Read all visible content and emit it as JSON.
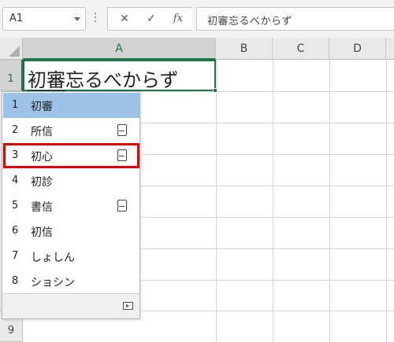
{
  "formula_bar": {
    "name_box": "A1",
    "cancel_icon": "✕",
    "enter_icon": "✓",
    "function_icon": "fx",
    "content": "初審忘るべからず"
  },
  "columns": [
    "A",
    "B",
    "C",
    "D"
  ],
  "rows": [
    "1",
    "9"
  ],
  "cell_a1": {
    "underlined_part": "初審",
    "rest": "忘るべからず"
  },
  "ime": {
    "candidates": [
      {
        "num": "1",
        "word": "初審",
        "dict": false
      },
      {
        "num": "2",
        "word": "所信",
        "dict": true
      },
      {
        "num": "3",
        "word": "初心",
        "dict": true
      },
      {
        "num": "4",
        "word": "初診",
        "dict": false
      },
      {
        "num": "5",
        "word": "書信",
        "dict": true
      },
      {
        "num": "6",
        "word": "初信",
        "dict": false
      },
      {
        "num": "7",
        "word": "しょしん",
        "dict": false
      },
      {
        "num": "8",
        "word": "ショシン",
        "dict": false
      }
    ],
    "selected": 1,
    "highlighted": 3
  },
  "colors": {
    "accent_green": "#217346",
    "selection_blue": "#9cc3e5",
    "highlight_red": "#e00000"
  }
}
